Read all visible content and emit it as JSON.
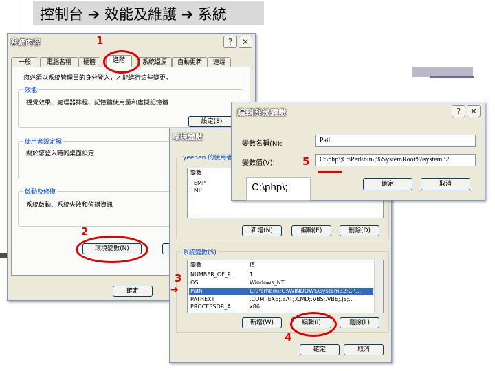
{
  "header": {
    "title": "控制台 ➔ 效能及維護 ➔ 系統"
  },
  "main_window": {
    "title": "系統內容",
    "help": "?",
    "close": "✕",
    "tabs": [
      "一般",
      "電腦名稱",
      "硬體",
      "進階",
      "系統還原",
      "自動更新",
      "遠端"
    ],
    "intro": "您必須以系統管理員的身分登入，才能進行這些變更。",
    "perf_label": "效能",
    "perf_text": "視覺效果、處理器排程、記憶體使用量和虛擬記憶體",
    "settings_btn": "設定(S)",
    "profile_label": "使用者設定檔",
    "profile_text": "關於您登入時的桌面設定",
    "startup_label": "啟動及修復",
    "startup_text": "系統啟動、系統失敗和偵錯資訊",
    "env_btn": "環境變數(N)",
    "ok_btn": "確定"
  },
  "env_window": {
    "title": "環境變數",
    "user_label": "yeenen 的使用者",
    "col_var": "變數",
    "col_val": "值",
    "user_vars": [
      "TEMP",
      "TMP"
    ],
    "new_btn": "新增(N)",
    "edit_btn": "編輯(E)",
    "delete_btn": "刪除(D)",
    "sys_label": "系統變數(S)",
    "sys_rows": [
      {
        "name": "NUMBER_OF_P...",
        "value": "1"
      },
      {
        "name": "OS",
        "value": "Windows_NT"
      },
      {
        "name": "Path",
        "value": "C:\\Perl\\bin\\;C:\\WINDOWS\\system32;C:\\..."
      },
      {
        "name": "PATHEXT",
        "value": ".COM;.EXE;.BAT;.CMD;.VBS;.VBE;.JS;..."
      },
      {
        "name": "PROCESSOR_A...",
        "value": "x86"
      }
    ],
    "sys_new_btn": "新增(W)",
    "sys_edit_btn": "編輯(I)",
    "sys_delete_btn": "刪除(L)",
    "ok_btn": "確定",
    "cancel_btn": "取消"
  },
  "edit_window": {
    "title": "編輯系統變數",
    "name_label": "變數名稱(N):",
    "name_value": "Path",
    "value_label": "變數值(V):",
    "value_value": "C:\\php\\;C:\\Perl\\bin\\;%SystemRoot%\\system32",
    "ok_btn": "確定",
    "cancel_btn": "取消"
  },
  "callout": {
    "text": "C:\\php\\;"
  },
  "markers": {
    "m1": "1",
    "m2": "2",
    "m3": "3",
    "m4": "4",
    "m5": "5",
    "arrow": "➔"
  },
  "colors": {
    "accent_red": "#e00000",
    "dialog_bg": "#ece9d8",
    "selection": "#316ac5"
  }
}
